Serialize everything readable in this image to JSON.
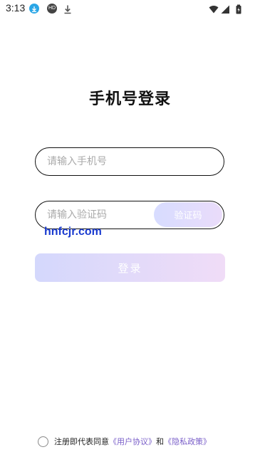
{
  "status_bar": {
    "time": "3:13",
    "hd_badge": "HD",
    "icons": [
      "download-badge-icon",
      "hd-badge-icon",
      "download-icon",
      "wifi-icon",
      "signal-icon",
      "battery-icon"
    ]
  },
  "page": {
    "title": "手机号登录"
  },
  "form": {
    "phone_placeholder": "请输入手机号",
    "phone_value": "",
    "code_placeholder": "请输入验证码",
    "code_value": "",
    "code_button_label": "验证码",
    "login_button_label": "登录"
  },
  "watermark": "hnfcjr.com",
  "agreement": {
    "prefix": "注册即代表同意",
    "user_agreement": "《用户协议》",
    "conjunction": "和",
    "privacy_policy": "《隐私政策》",
    "checked": false
  },
  "colors": {
    "background": "#ffffff",
    "accent_start": "#d4d8fc",
    "accent_end": "#f0dcf7",
    "link": "#7a5fc9",
    "border": "#111111"
  }
}
